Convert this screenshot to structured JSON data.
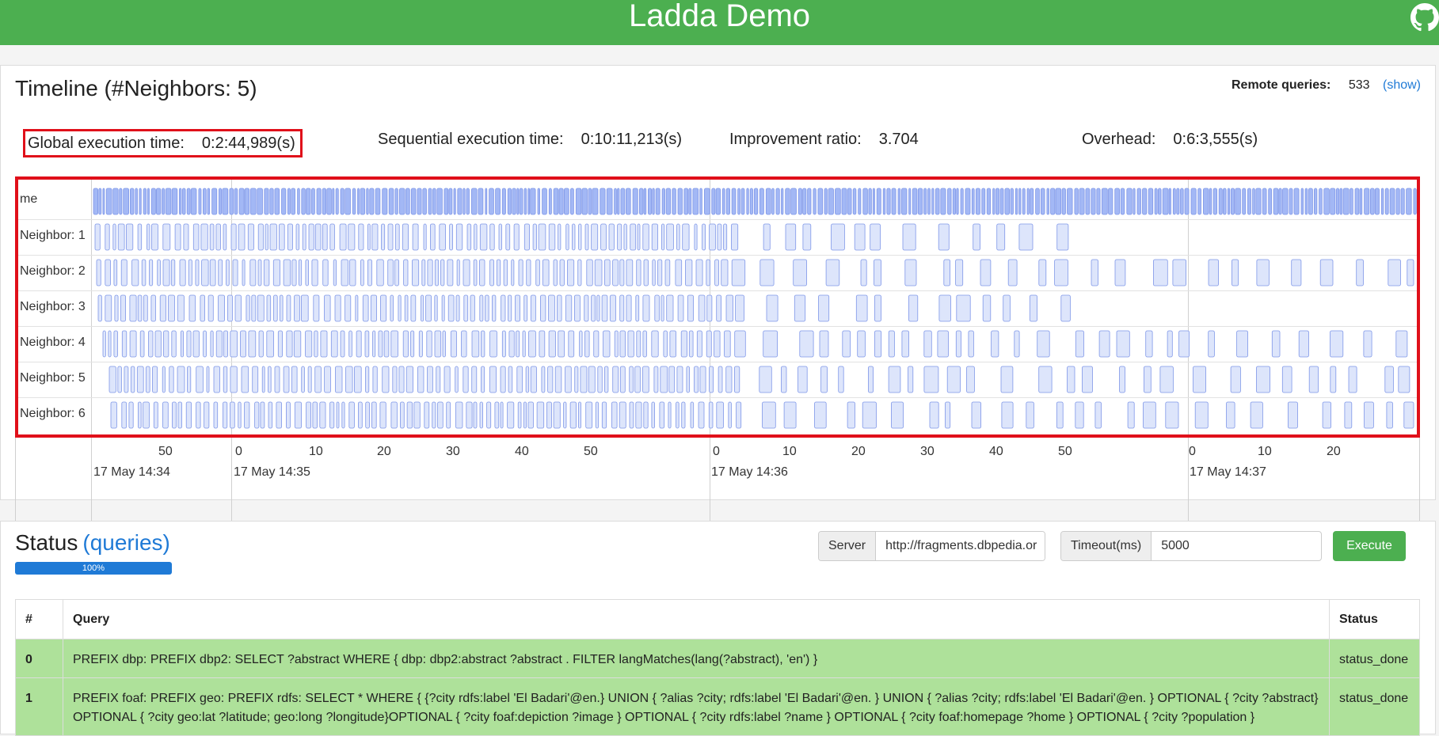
{
  "header": {
    "title": "Ladda Demo",
    "icon": "github-icon",
    "color": "#4caf50"
  },
  "timeline": {
    "title": "Timeline (#Neighbors: 5)",
    "remote_label": "Remote queries:",
    "remote_count": "533",
    "show_link": "(show)",
    "stats": {
      "global_label": "Global execution time:",
      "global_value": "0:2:44,989(s)",
      "sequential_label": "Sequential execution time:",
      "sequential_value": "0:10:11,213(s)",
      "ratio_label": "Improvement ratio:",
      "ratio_value": "3.704",
      "overhead_label": "Overhead:",
      "overhead_value": "0:6:3,555(s)"
    },
    "rows": [
      {
        "label": "me"
      },
      {
        "label": "Neighbor: 1"
      },
      {
        "label": "Neighbor: 2"
      },
      {
        "label": "Neighbor: 3"
      },
      {
        "label": "Neighbor: 4"
      },
      {
        "label": "Neighbor: 5"
      },
      {
        "label": "Neighbor: 6"
      }
    ],
    "minor_ticks": [
      "50",
      "0",
      "10",
      "20",
      "30",
      "40",
      "50",
      "0",
      "10",
      "20",
      "30",
      "40",
      "50",
      "0",
      "10",
      "20"
    ],
    "major_ticks": [
      "17 May 14:34",
      "17 May 14:35",
      "17 May 14:36",
      "17 May 14:37"
    ],
    "bar_color": "#a3b8f5"
  },
  "status": {
    "title": "Status",
    "queries_link": "(queries)",
    "progress_text": "100%",
    "progress_value": 100,
    "server_label": "Server",
    "server_value": "http://fragments.dbpedia.org",
    "timeout_label": "Timeout(ms)",
    "timeout_value": "5000",
    "execute_label": "Execute",
    "table": {
      "headers": [
        "#",
        "Query",
        "Status"
      ],
      "rows": [
        {
          "id": "0",
          "query": "PREFIX dbp: PREFIX dbp2: SELECT ?abstract WHERE { dbp: dbp2:abstract ?abstract . FILTER langMatches(lang(?abstract), 'en') }",
          "status": "status_done"
        },
        {
          "id": "1",
          "query": "PREFIX foaf: PREFIX geo: PREFIX rdfs: SELECT * WHERE { {?city rdfs:label 'El Badari'@en.} UNION { ?alias ?city; rdfs:label 'El Badari'@en. } UNION { ?alias ?city; rdfs:label 'El Badari'@en. } OPTIONAL { ?city ?abstract} OPTIONAL { ?city geo:lat ?latitude; geo:long ?longitude}OPTIONAL { ?city foaf:depiction ?image } OPTIONAL { ?city rdfs:label ?name } OPTIONAL { ?city foaf:homepage ?home } OPTIONAL { ?city ?population }",
          "status": "status_done"
        }
      ]
    }
  }
}
